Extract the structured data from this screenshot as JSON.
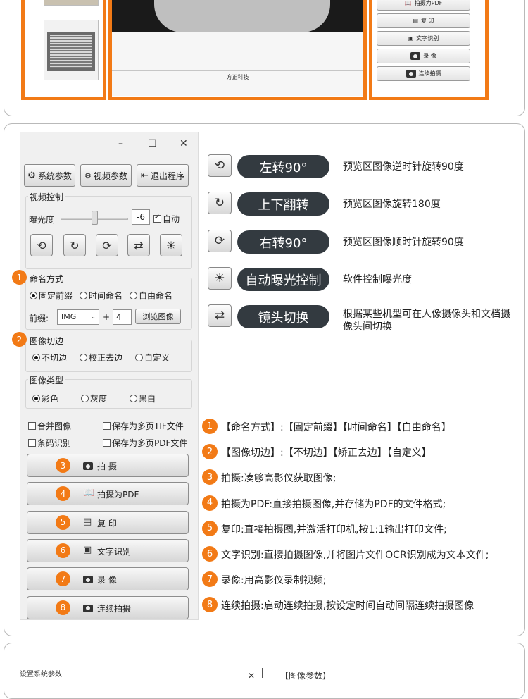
{
  "top_preview": {
    "brand_footer": "方正科技",
    "camera_buttons": [
      {
        "label": "拍摄为PDF",
        "icon": "book-icon"
      },
      {
        "label": "复  印",
        "icon": "copier-icon"
      },
      {
        "label": "文字识别",
        "icon": "ocr-icon"
      },
      {
        "label": "录  像",
        "icon": "camera-icon"
      },
      {
        "label": "连续拍摄",
        "icon": "camera-icon"
      }
    ]
  },
  "dialog": {
    "window_controls": {
      "minimize": "–",
      "maximize": "☐",
      "close": "✕"
    },
    "toolbar": {
      "system_params": "系统参数",
      "video_params": "视频参数",
      "exit": "退出程序"
    },
    "video_control": {
      "label": "视频控制",
      "exposure_label": "曝光度",
      "exposure_value": "-6",
      "exposure_slider_fraction": 0.5,
      "auto_label": "自动",
      "auto_checked": true
    },
    "naming": {
      "label": "命名方式",
      "options": [
        "固定前缀",
        "时间命名",
        "自由命名"
      ],
      "selected": 0,
      "prefix_label": "前缀:",
      "prefix_value": "IMG",
      "plus": "+",
      "counter_value": "4",
      "browse_label": "浏览图像"
    },
    "cropping": {
      "label": "图像切边",
      "options": [
        "不切边",
        "校正去边",
        "自定义"
      ],
      "selected": 0
    },
    "image_type": {
      "label": "图像类型",
      "options": [
        "彩色",
        "灰度",
        "黑白"
      ],
      "selected": 0
    },
    "checkboxes": {
      "merge": "合并图像",
      "save_tif": "保存为多页TIF文件",
      "barcode": "条码识别",
      "save_pdf": "保存为多页PDF文件"
    },
    "action_buttons": [
      {
        "badge": "3",
        "label": "拍   摄",
        "icon": "camera-icon"
      },
      {
        "badge": "4",
        "label": "拍摄为PDF",
        "icon": "book-icon"
      },
      {
        "badge": "5",
        "label": "复    印",
        "icon": "copier-icon"
      },
      {
        "badge": "6",
        "label": "文字识别",
        "icon": "ocr-icon"
      },
      {
        "badge": "7",
        "label": "录    像",
        "icon": "camera-icon"
      },
      {
        "badge": "8",
        "label": "连续拍摄",
        "icon": "camera-icon"
      }
    ],
    "group_badges": [
      "1",
      "2"
    ]
  },
  "legend": [
    {
      "icon": "rotate-left-icon",
      "pill": "左转90°",
      "desc": "预览区图像逆时针旋转90度"
    },
    {
      "icon": "flip-icon",
      "pill": "上下翻转",
      "desc": "预览区图像旋转180度"
    },
    {
      "icon": "rotate-right-icon",
      "pill": "右转90°",
      "desc": "预览区图像顺时针旋转90度"
    },
    {
      "icon": "exposure-icon",
      "pill": "自动曝光控制",
      "desc": "软件控制曝光度"
    },
    {
      "icon": "lens-switch-icon",
      "pill": "镜头切换",
      "desc": "根据某些机型可在人像摄像头和文档摄像头间切换"
    }
  ],
  "features": [
    {
      "n": "1",
      "text": "【命名方式】:【固定前缀】【时间命名】【自由命名】"
    },
    {
      "n": "2",
      "text": "【图像切边】:【不切边】【矫正去边】【自定义】"
    },
    {
      "n": "3",
      "text": "拍摄:凑够高影仪获取图像;"
    },
    {
      "n": "4",
      "text": "拍摄为PDF:直接拍摄图像,并存储为PDF的文件格式;"
    },
    {
      "n": "5",
      "text": "复印:直接拍摄图,并激活打印机,按1:1输出打印文件;"
    },
    {
      "n": "6",
      "text": "文字识别:直接拍摄图像,并将图片文件OCR识别成为文本文件;"
    },
    {
      "n": "7",
      "text": "录像:用高影仪录制视频;"
    },
    {
      "n": "8",
      "text": "连续拍摄:启动连续拍摄,按设定时间自动间隔连续拍摄图像"
    }
  ],
  "bottom_card": {
    "title": "设置系统参数",
    "close": "✕",
    "right_title": "【图像参数】"
  },
  "colors": {
    "accent": "#f27a16",
    "pill": "#333a40"
  }
}
